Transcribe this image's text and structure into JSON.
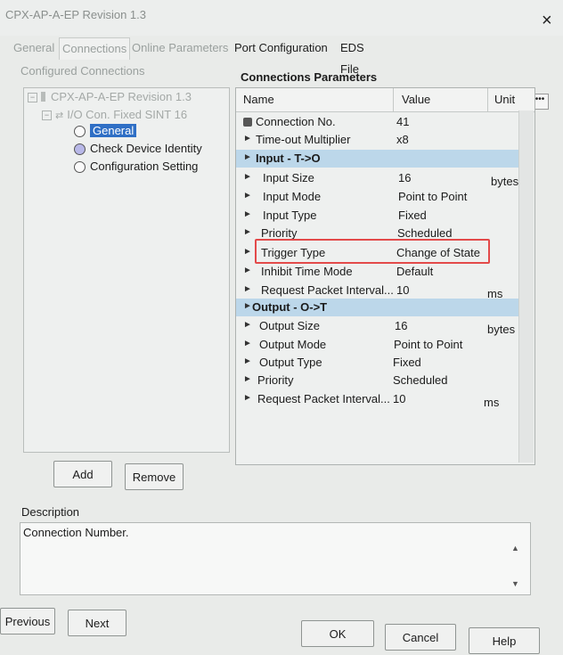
{
  "window": {
    "title": "CPX-AP-A-EP Revision 1.3",
    "close_glyph": "×"
  },
  "tabs": [
    {
      "label": "General"
    },
    {
      "label": "Connections"
    },
    {
      "label": "Online Parameters"
    },
    {
      "label": "Port Configuration"
    },
    {
      "label": "EDS File"
    }
  ],
  "left": {
    "section_label": "Configured Connections",
    "tree": {
      "root": "CPX-AP-A-EP Revision 1.3",
      "connection": "I/O Con. Fixed SINT 16",
      "children": [
        "General",
        "Check Device Identity",
        "Configuration Setting"
      ]
    }
  },
  "params": {
    "section_label": "Connections Parameters",
    "columns": {
      "name": "Name",
      "value": "Value",
      "unit": "Unit"
    },
    "more_glyph": "•••",
    "rows": [
      {
        "name": "Connection No.",
        "value": "41",
        "unit": ""
      },
      {
        "name": "Time-out Multiplier",
        "value": "x8",
        "unit": ""
      },
      {
        "name": "Input - T->O",
        "value": "",
        "unit": ""
      },
      {
        "name": "Input Size",
        "value": "16",
        "unit": "bytes"
      },
      {
        "name": "Input Mode",
        "value": "Point to Point",
        "unit": ""
      },
      {
        "name": "Input Type",
        "value": "Fixed",
        "unit": ""
      },
      {
        "name": "Priority",
        "value": "Scheduled",
        "unit": ""
      },
      {
        "name": "Trigger Type",
        "value": "Change of State",
        "unit": ""
      },
      {
        "name": "Inhibit Time Mode",
        "value": "Default",
        "unit": ""
      },
      {
        "name": "Request Packet Interval...",
        "value": "10",
        "unit": "ms"
      },
      {
        "name": "Output - O->T",
        "value": "",
        "unit": ""
      },
      {
        "name": "Output Size",
        "value": "16",
        "unit": "bytes"
      },
      {
        "name": "Output Mode",
        "value": "Point to Point",
        "unit": ""
      },
      {
        "name": "Output Type",
        "value": "Fixed",
        "unit": ""
      },
      {
        "name": "Priority",
        "value": "Scheduled",
        "unit": ""
      },
      {
        "name": "Request Packet Interval...",
        "value": "10",
        "unit": "ms"
      }
    ]
  },
  "buttons": {
    "add": "Add",
    "remove": "Remove",
    "previous": "Previous",
    "next": "Next",
    "ok": "OK",
    "cancel": "Cancel",
    "help": "Help"
  },
  "description": {
    "label": "Description",
    "text": "Connection Number."
  },
  "colors": {
    "accent": "#2f6fc5",
    "group_row": "#bcd7ea",
    "highlight": "#e34a4a"
  },
  "icons": {
    "close": "close-icon",
    "lock": "lock-icon",
    "row_arrow": "arrow-right-icon"
  }
}
